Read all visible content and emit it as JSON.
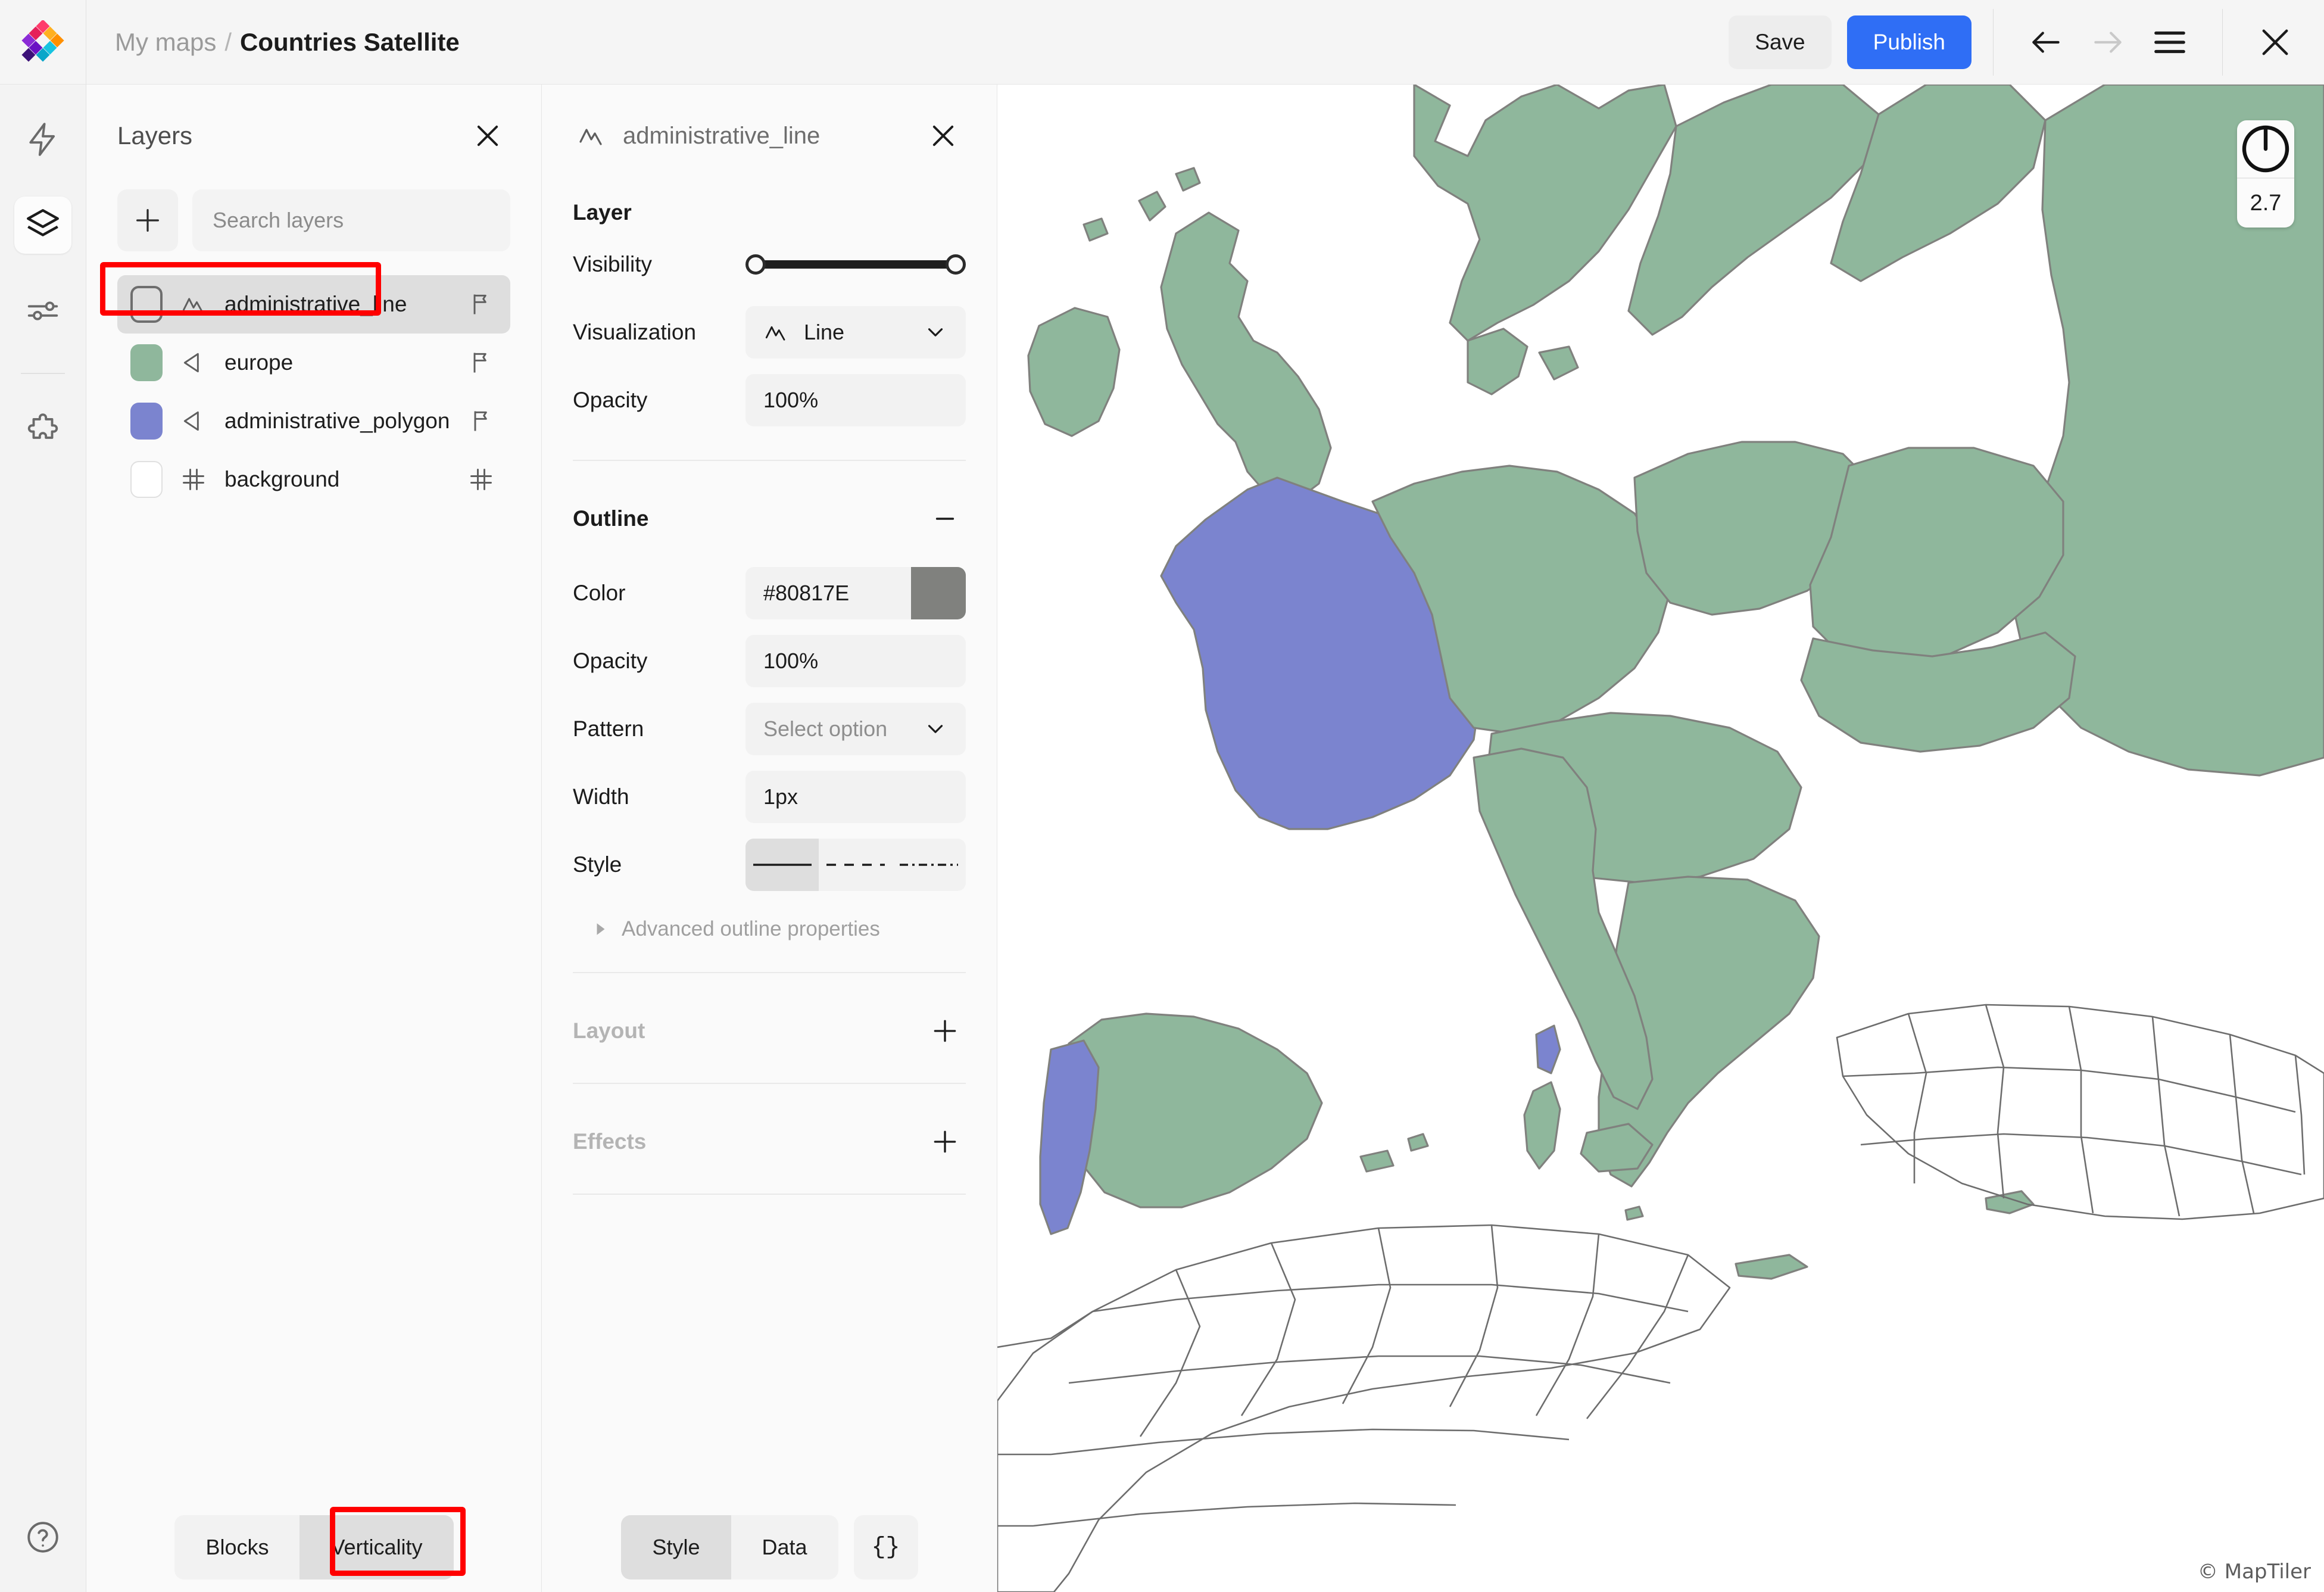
{
  "header": {
    "logo_icon": "maptiler-diamond-logo",
    "breadcrumb_parent": "My maps",
    "breadcrumb_separator": "/",
    "breadcrumb_current": "Countries Satellite",
    "save_label": "Save",
    "publish_label": "Publish",
    "back_icon": "arrow-left-icon",
    "forward_icon": "arrow-right-icon",
    "menu_icon": "hamburger-menu-icon",
    "close_icon": "close-icon",
    "publish_color": "#2f6ef5"
  },
  "rail": {
    "items": [
      {
        "icon": "lightning-bolt-icon",
        "active": false
      },
      {
        "icon": "layers-stack-icon",
        "active": true
      },
      {
        "icon": "sliders-icon",
        "active": false
      },
      {
        "icon": "puzzle-piece-icon",
        "active": false
      }
    ],
    "help_icon": "help-circle-icon"
  },
  "layers_panel": {
    "title": "Layers",
    "close_icon": "close-icon",
    "add_icon": "plus-icon",
    "search_placeholder": "Search layers",
    "search_value": "",
    "layers": [
      {
        "name": "administrative_line",
        "swatch": "",
        "type_icon": "line-icon",
        "right_icon": "flag-icon",
        "selected": true,
        "highlighted": true
      },
      {
        "name": "europe",
        "swatch": "#8fb79c",
        "type_icon": "polygon-icon",
        "right_icon": "flag-icon",
        "selected": false,
        "highlighted": false
      },
      {
        "name": "administrative_polygon",
        "swatch": "#7b84cf",
        "type_icon": "polygon-icon",
        "right_icon": "flag-icon",
        "selected": false,
        "highlighted": false
      },
      {
        "name": "background",
        "swatch": "#ffffff",
        "type_icon": "grid-icon",
        "right_icon": "grid-icon",
        "selected": false,
        "highlighted": false
      }
    ],
    "bottom_tabs": [
      {
        "label": "Blocks",
        "active": false,
        "highlighted": false
      },
      {
        "label": "Verticality",
        "active": true,
        "highlighted": true
      }
    ]
  },
  "style_panel": {
    "icon": "line-icon",
    "title": "administrative_line",
    "close_icon": "close-icon",
    "sections": {
      "layer": {
        "title": "Layer",
        "visibility_label": "Visibility",
        "visibility_min": 0,
        "visibility_max": 100,
        "visualization_label": "Visualization",
        "visualization_value": "Line",
        "visualization_icon": "line-icon",
        "opacity_label": "Opacity",
        "opacity_value": "100%"
      },
      "outline": {
        "title": "Outline",
        "collapse_icon": "minus-icon",
        "color_label": "Color",
        "color_value": "#80817E",
        "opacity_label": "Opacity",
        "opacity_value": "100%",
        "pattern_label": "Pattern",
        "pattern_value": "Select option",
        "width_label": "Width",
        "width_value": "1px",
        "style_label": "Style",
        "style_options": [
          {
            "name": "solid-line",
            "active": true
          },
          {
            "name": "dashed-line",
            "active": false
          },
          {
            "name": "dash-dot-line",
            "active": false
          }
        ],
        "advanced_label": "Advanced outline properties",
        "advanced_icon": "triangle-right-icon"
      },
      "layout": {
        "title": "Layout",
        "add_icon": "plus-icon"
      },
      "effects": {
        "title": "Effects",
        "add_icon": "plus-icon"
      }
    },
    "bottom_tabs": [
      {
        "label": "Style",
        "active": true
      },
      {
        "label": "Data",
        "active": false
      }
    ],
    "json_button_label": "{}"
  },
  "map": {
    "zoom_control_icon": "compass-dial-icon",
    "zoom_value": "2.7",
    "attribution": "© MapTiler",
    "fill_green": "#8fb79c",
    "fill_purple": "#7b84cf",
    "stroke_color": "#80817e",
    "unfilled_stroke": "#6d6d6d"
  }
}
